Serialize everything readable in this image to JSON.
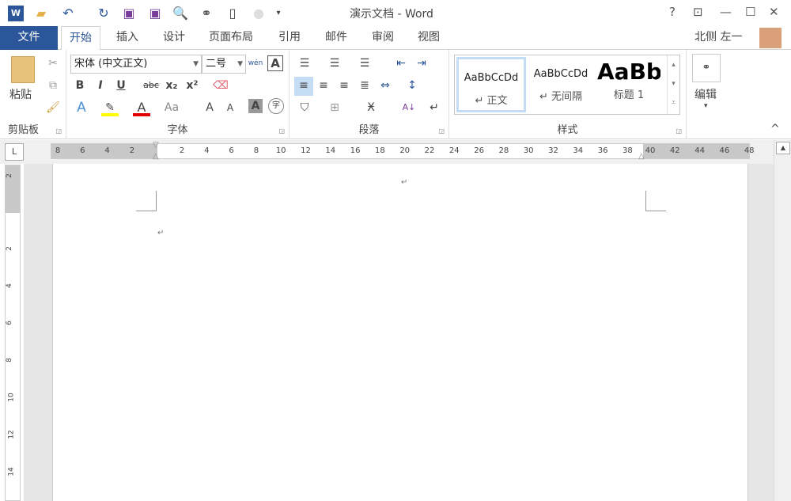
{
  "window": {
    "title": "演示文档 - Word",
    "help": "?",
    "controls": [
      "restore-ribbon",
      "minimize",
      "maximize",
      "close"
    ]
  },
  "tabs": {
    "file": "文件",
    "items": [
      "开始",
      "插入",
      "设计",
      "页面布局",
      "引用",
      "邮件",
      "审阅",
      "视图"
    ],
    "user": "北侧 左一"
  },
  "ribbon": {
    "clipboard": {
      "paste": "粘贴",
      "label": "剪贴板"
    },
    "font": {
      "name": "宋体 (中文正文)",
      "size": "二号",
      "label": "字体",
      "bold": "B",
      "italic": "I",
      "underline": "U",
      "strike": "abc",
      "sub": "x₂",
      "sup": "x²",
      "color_letter": "A",
      "case": "Aa",
      "grow": "A",
      "shrink": "A",
      "shade": "A",
      "enclose": "字",
      "phonetic": "wén",
      "highlight_color": "#ffff00",
      "font_color": "#e00000"
    },
    "paragraph": {
      "label": "段落"
    },
    "styles": {
      "label": "样式",
      "items": [
        {
          "sample": "AaBbCcDd",
          "name": "↵ 正文"
        },
        {
          "sample": "AaBbCcDd",
          "name": "↵ 无间隔"
        },
        {
          "sample": "AaBb",
          "name": "标题 1"
        }
      ]
    },
    "editing": {
      "label": "编辑"
    }
  },
  "ruler": {
    "corner": "L",
    "left_ticks": [
      "8",
      "6",
      "4",
      "2"
    ],
    "ticks": [
      "2",
      "4",
      "6",
      "8",
      "10",
      "12",
      "14",
      "16",
      "18",
      "20",
      "22",
      "24",
      "26",
      "28",
      "30",
      "32",
      "34",
      "36",
      "38"
    ],
    "right_ticks": [
      "40",
      "42",
      "44",
      "46",
      "48"
    ],
    "vertical_ticks": [
      "2",
      "2",
      "4",
      "6",
      "8",
      "10",
      "12",
      "14"
    ]
  },
  "document": {
    "para_mark": "↵"
  },
  "colors": {
    "accent": "#2b579a"
  }
}
